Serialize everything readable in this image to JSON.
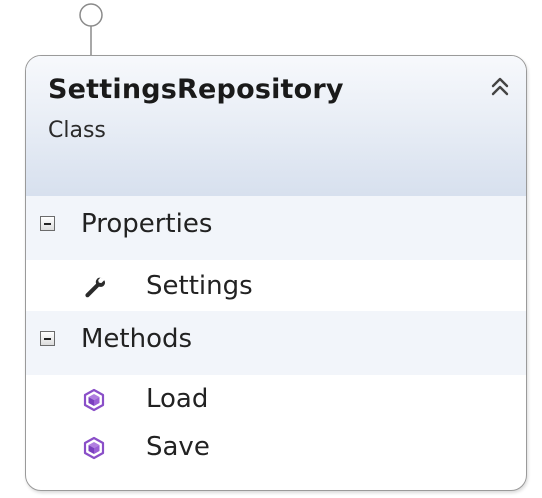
{
  "class": {
    "name": "SettingsRepository",
    "stereotype": "Class"
  },
  "sections": [
    {
      "label": "Properties",
      "members": [
        {
          "label": "Settings",
          "icon": "wrench-icon"
        }
      ]
    },
    {
      "label": "Methods",
      "members": [
        {
          "label": "Load",
          "icon": "method-cube-icon"
        },
        {
          "label": "Save",
          "icon": "method-cube-icon"
        }
      ]
    }
  ],
  "colors": {
    "header_gradient_top": "#f7f9fc",
    "header_gradient_bottom": "#d7e0ee",
    "method_icon": "#8a4fc8",
    "border": "#9a9a9a"
  }
}
